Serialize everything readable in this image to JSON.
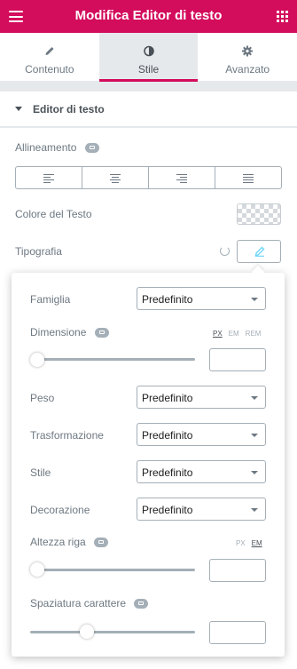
{
  "header": {
    "title": "Modifica Editor di testo"
  },
  "tabs": [
    {
      "label": "Contenuto",
      "icon": "pencil-icon",
      "active": false
    },
    {
      "label": "Stile",
      "icon": "half-circle-icon",
      "active": true
    },
    {
      "label": "Avanzato",
      "icon": "gear-icon",
      "active": false
    }
  ],
  "section": {
    "title": "Editor di testo"
  },
  "controls": {
    "alignment_label": "Allineamento",
    "alignment_options": [
      "align-left-icon",
      "align-center-icon",
      "align-right-icon",
      "align-justify-icon"
    ],
    "text_color_label": "Colore del Testo",
    "typography_label": "Tipografia"
  },
  "typography": {
    "family": {
      "label": "Famiglia",
      "value": "Predefinito"
    },
    "size": {
      "label": "Dimensione",
      "units": [
        "PX",
        "EM",
        "REM"
      ],
      "active_unit": "PX",
      "slider": 0.0,
      "value": ""
    },
    "weight": {
      "label": "Peso",
      "value": "Predefinito"
    },
    "transform": {
      "label": "Trasformazione",
      "value": "Predefinito"
    },
    "style": {
      "label": "Stile",
      "value": "Predefinito"
    },
    "decoration": {
      "label": "Decorazione",
      "value": "Predefinito"
    },
    "line_height": {
      "label": "Altezza riga",
      "units": [
        "PX",
        "EM"
      ],
      "active_unit": "EM",
      "slider": 0.0,
      "value": ""
    },
    "letter_spacing": {
      "label": "Spaziatura carattere",
      "slider": 0.33,
      "value": ""
    }
  },
  "colors": {
    "accent": "#d30c5c",
    "muted": "#a4afb7",
    "text": "#6d7882"
  }
}
